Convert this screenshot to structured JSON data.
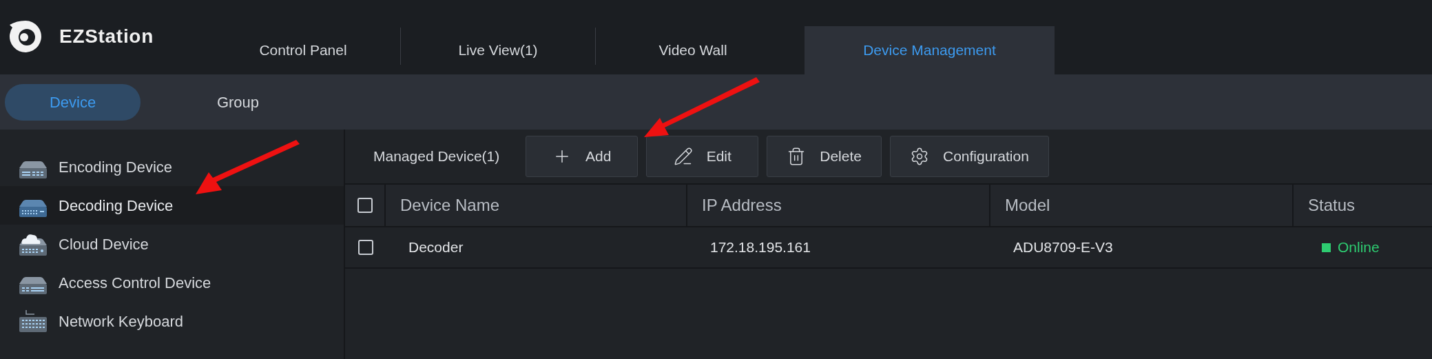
{
  "app": {
    "title": "EZStation"
  },
  "tabs": [
    {
      "label": "Control Panel",
      "selected": false
    },
    {
      "label": "Live View(1)",
      "selected": false
    },
    {
      "label": "Video Wall",
      "selected": false
    },
    {
      "label": "Device Management",
      "selected": true
    }
  ],
  "subtabs": [
    {
      "label": "Device",
      "selected": true
    },
    {
      "label": "Group",
      "selected": false
    }
  ],
  "sidebar": {
    "items": [
      {
        "label": "Encoding Device",
        "kind": "encoding",
        "selected": false
      },
      {
        "label": "Decoding Device",
        "kind": "decoding",
        "selected": true
      },
      {
        "label": "Cloud Device",
        "kind": "cloud",
        "selected": false
      },
      {
        "label": "Access Control Device",
        "kind": "access",
        "selected": false
      },
      {
        "label": "Network Keyboard",
        "kind": "keyboard",
        "selected": false
      }
    ]
  },
  "toolbar": {
    "label": "Managed Device(1)",
    "buttons": [
      {
        "label": "Add",
        "kind": "add"
      },
      {
        "label": "Edit",
        "kind": "edit"
      },
      {
        "label": "Delete",
        "kind": "delete"
      },
      {
        "label": "Configuration",
        "kind": "configure"
      }
    ]
  },
  "table": {
    "all_checked": false,
    "columns": [
      "Device Name",
      "IP Address",
      "Model",
      "Status"
    ],
    "rows": [
      {
        "checked": false,
        "cells": [
          "Decoder",
          "172.18.195.161",
          "ADU8709-E-V3"
        ],
        "status": "Online",
        "online": true
      }
    ]
  }
}
